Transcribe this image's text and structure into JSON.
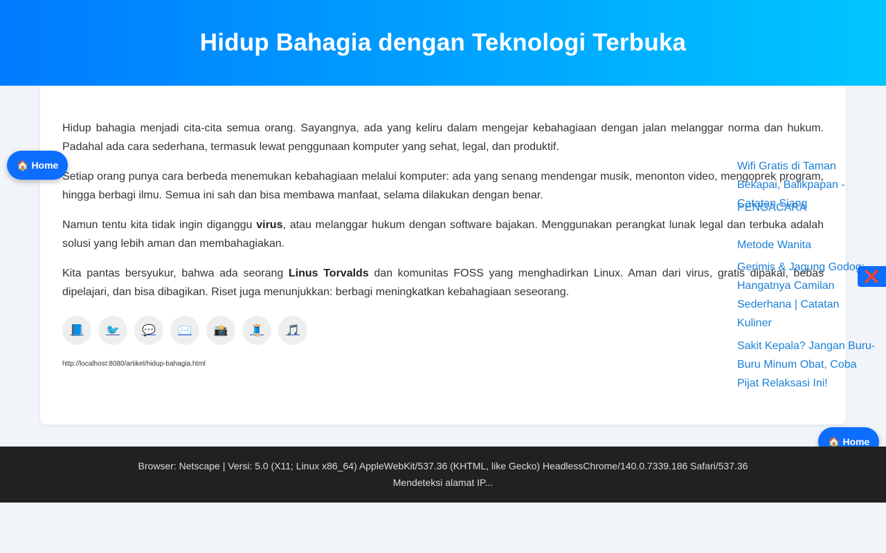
{
  "header": {
    "title": "Hidup Bahagia dengan Teknologi Terbuka"
  },
  "article": {
    "p1": " Hidup bahagia menjadi cita-cita semua orang. Sayangnya, ada yang keliru dalam mengejar kebahagiaan dengan jalan melanggar norma dan hukum. Padahal ada cara sederhana, termasuk lewat penggunaan komputer yang sehat, legal, dan produktif.",
    "p2": "Setiap orang punya cara berbeda menemukan kebahagiaan melalui komputer: ada yang senang mendengar musik, menonton video, mengoprek program, hingga berbagi ilmu. Semua ini sah dan bisa membawa manfaat, selama dilakukan dengan benar.",
    "p3_a": "Namun tentu kita tidak ingin diganggu ",
    "p3_b": "virus",
    "p3_c": ", atau melanggar hukum dengan software bajakan. Menggunakan perangkat lunak legal dan terbuka adalah solusi yang lebih aman dan membahagiakan.",
    "p4_a": " Kita pantas bersyukur, bahwa ada seorang ",
    "p4_b": "Linus Torvalds",
    "p4_c": " dan komunitas FOSS yang menghadirkan Linux. Aman dari virus, gratis dipakai, bebas dipelajari, dan bisa dibagikan. Riset juga menunjukkan: berbagi meningkatkan kebahagiaan seseorang."
  },
  "share": [
    {
      "name": "facebook-icon",
      "glyph": "📘"
    },
    {
      "name": "twitter-icon",
      "glyph": "🐦"
    },
    {
      "name": "whatsapp-icon",
      "glyph": "💬"
    },
    {
      "name": "email-icon",
      "glyph": "✉️"
    },
    {
      "name": "instagram-icon",
      "glyph": "📸"
    },
    {
      "name": "threads-icon",
      "glyph": "🧵"
    },
    {
      "name": "tiktok-icon",
      "glyph": "🎵"
    }
  ],
  "page_url": "http://localhost:8080/artikel/hidup-bahagia.html",
  "home_button": {
    "icon": "🏠",
    "label": "Home"
  },
  "related": [
    "Wifi Gratis di Taman Bekapai, Balikpapan - Catatan Siang",
    "PENGACARA",
    "Metode Wanita",
    "Gerimis & Jagung Godog:",
    "Hangatnya Camilan Sederhana | Catatan Kuliner",
    "Sakit Kepala? Jangan Buru-Buru Minum Obat, Coba Pijat Relaksasi Ini!"
  ],
  "close_icon": "❌",
  "footer": {
    "browser_line": "Browser: Netscape | Versi: 5.0 (X11; Linux x86_64) AppleWebKit/537.36 (KHTML, like Gecko) HeadlessChrome/140.0.7339.186 Safari/537.36",
    "ip_line": "Mendeteksi alamat IP..."
  },
  "colors": {
    "header_gradient_start": "#007bff",
    "header_gradient_end": "#00c6ff",
    "button_blue": "#0d6efd",
    "link_blue": "#1a7fd6",
    "footer_bg": "#212121"
  }
}
